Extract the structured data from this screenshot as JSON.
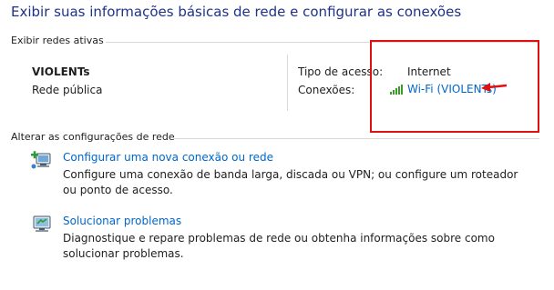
{
  "title": "Exibir suas informações básicas de rede e configurar as conexões",
  "active_networks": {
    "section_label": "Exibir redes ativas",
    "network_name": "VIOLENTs",
    "network_type": "Rede pública",
    "access_type_label": "Tipo de acesso:",
    "access_type_value": "Internet",
    "connections_label": "Conexões:",
    "connection_link": "Wi-Fi (VIOLENTs)",
    "connection_icon": "wifi-signal-icon"
  },
  "change_settings": {
    "section_label": "Alterar as configurações de rede",
    "tasks": [
      {
        "icon": "new-connection-icon",
        "link": "Configurar uma nova conexão ou rede",
        "description": "Configure uma conexão de banda larga, discada ou VPN; ou configure um roteador ou ponto de acesso."
      },
      {
        "icon": "troubleshoot-icon",
        "link": "Solucionar problemas",
        "description": "Diagnostique e repare problemas de rede ou obtenha informações sobre como solucionar problemas."
      }
    ]
  },
  "colors": {
    "title": "#1e3287",
    "link": "#0066cc",
    "annotation": "#e01010",
    "signal": "#3a9a2a"
  }
}
